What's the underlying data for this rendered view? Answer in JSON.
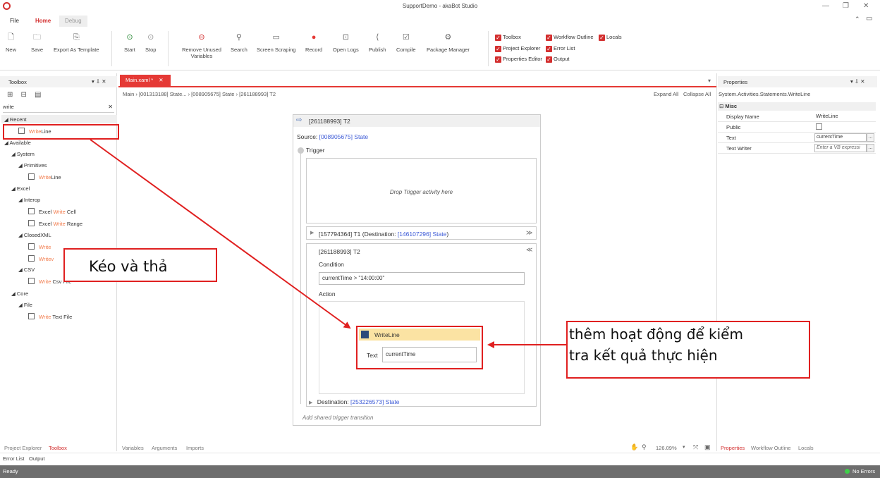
{
  "window": {
    "title": "SupportDemo - akaBot Studio"
  },
  "ribbon": {
    "tabs": [
      "File",
      "Home",
      "Debug"
    ],
    "buttons": {
      "new": "New",
      "save": "Save",
      "export": "Export As Template",
      "start": "Start",
      "stop": "Stop",
      "remove_unused_1": "Remove Unused",
      "remove_unused_2": "Variables",
      "search": "Search",
      "screen_scraping": "Screen Scraping",
      "record": "Record",
      "open_logs": "Open Logs",
      "publish": "Publish",
      "compile": "Compile",
      "package_manager": "Package Manager"
    },
    "checks": {
      "toolbox": "Toolbox",
      "workflow_outline": "Workflow Outline",
      "locals": "Locals",
      "project_explorer": "Project Explorer",
      "error_list": "Error List",
      "properties_editor": "Properties Editor",
      "output": "Output"
    }
  },
  "toolbox": {
    "title": "Toolbox",
    "search_value": "write",
    "recent": "Recent",
    "available": "Available",
    "system": "System",
    "primitives": "Primitives",
    "excel": "Excel",
    "interop": "Interop",
    "closedxml": "ClosedXML",
    "csv": "CSV",
    "core": "Core",
    "file": "File",
    "items": {
      "recent_writeline_a": "Write",
      "recent_writeline_b": "Line",
      "prim_writeline_a": "Write",
      "prim_writeline_b": "Line",
      "excel_write_cell_a": "Excel ",
      "excel_write_cell_b": "Write",
      "excel_write_cell_c": " Cell",
      "excel_write_range_a": "Excel ",
      "excel_write_range_b": "Write",
      "excel_write_range_c": " Range",
      "closed_write": "Write",
      "closed_writev": "Writev",
      "csv_write_a": "Write",
      "csv_write_b": " Csv File",
      "core_write_a": "Write",
      "core_write_b": " Text File"
    }
  },
  "left_bottom_tabs": [
    "Project Explorer",
    "Toolbox"
  ],
  "bottom_tabs2": [
    "Error List",
    "Output"
  ],
  "doc_tab": {
    "label": "Main.xaml *",
    "close": "✕"
  },
  "breadcrumb": {
    "items": [
      "Main",
      "[001313188] State...",
      "[008905675] State",
      "[261188993] T2"
    ],
    "expand_all": "Expand All",
    "collapse_all": "Collapse All"
  },
  "designer": {
    "header": "[261188993] T2",
    "source_label": "Source:",
    "source_value": "[008905675] State",
    "trigger_label": "Trigger",
    "drop_trigger": "Drop Trigger activity here",
    "t1_a": "[157794364] T1 (Destination: ",
    "t1_b": "[146107296] State",
    "t1_c": ")",
    "t2_title": "[261188993] T2",
    "condition_label": "Condition",
    "condition_value": "currentTime > \"14:00:00\"",
    "action_label": "Action",
    "writeline_title": "WriteLine",
    "text_label": "Text",
    "text_value": "currentTime",
    "destination_label": "Destination:",
    "destination_value": "[253226573] State",
    "add_shared": "Add shared trigger transition"
  },
  "annotations": {
    "drag_drop": "Kéo và thả",
    "add_activity_1": "thêm hoạt động để kiểm",
    "add_activity_2": "tra kết quả thực hiện"
  },
  "designer_bottom_tabs": [
    "Variables",
    "Arguments",
    "Imports"
  ],
  "zoom": "126.09%",
  "properties": {
    "title": "Properties",
    "type": "System.Activities.Statements.WriteLine",
    "section": "Misc",
    "rows": {
      "display_name_k": "Display Name",
      "display_name_v": "WriteLine",
      "public_k": "Public",
      "text_k": "Text",
      "text_v": "currentTime",
      "text_writer_k": "Text Writer",
      "text_writer_v": "Enter a VB expressi"
    },
    "bottom_tabs": [
      "Properties",
      "Workflow Outline",
      "Locals"
    ]
  },
  "status": {
    "left": "Ready",
    "right": "No Errors"
  },
  "colors": {
    "accent": "#d32f2f",
    "annotation_red": "#e02020",
    "link_blue": "#3b59d6",
    "writeline_header": "#fbe3a3"
  }
}
